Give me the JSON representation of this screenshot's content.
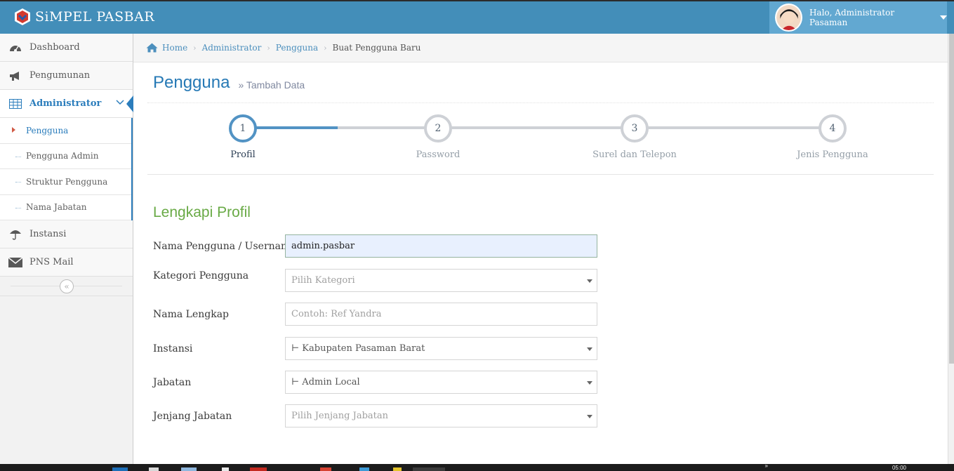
{
  "app": {
    "brand": "SiMPEL PASBAR",
    "greeting": "Halo, Administrator Pasaman"
  },
  "sidebar": {
    "items": [
      {
        "label": "Dashboard",
        "icon": "dashboard-icon"
      },
      {
        "label": "Pengumunan",
        "icon": "bullhorn-icon"
      },
      {
        "label": "Administrator",
        "icon": "table-icon",
        "active": true
      },
      {
        "label": "Instansi",
        "icon": "umbrella-icon"
      },
      {
        "label": "PNS Mail",
        "icon": "envelope-icon"
      }
    ],
    "submenu": [
      "Pengguna",
      "Pengguna Admin",
      "Struktur Pengguna",
      "Nama Jabatan"
    ],
    "collapse_glyph": "«"
  },
  "breadcrumb": [
    "Home",
    "Administrator",
    "Pengguna",
    "Buat Pengguna Baru"
  ],
  "page": {
    "title": "Pengguna",
    "subtitle": "» Tambah Data"
  },
  "wizard": {
    "current_step": 1,
    "steps": [
      {
        "num": "1",
        "title": "Profil"
      },
      {
        "num": "2",
        "title": "Password"
      },
      {
        "num": "3",
        "title": "Surel dan Telepon"
      },
      {
        "num": "4",
        "title": "Jenis Pengguna"
      }
    ]
  },
  "form": {
    "section_title": "Lengkapi Profil",
    "username": {
      "label": "Nama Pengguna / Username",
      "value": "admin.pasbar"
    },
    "kategori": {
      "label": "Kategori Pengguna",
      "placeholder": "Pilih Kategori"
    },
    "nama_lengkap": {
      "label": "Nama Lengkap",
      "placeholder": "Contoh: Ref Yandra"
    },
    "instansi": {
      "label": "Instansi",
      "value": "⊢ Kabupaten Pasaman Barat"
    },
    "jabatan": {
      "label": "Jabatan",
      "value": "⊢ Admin Local"
    },
    "jenjang": {
      "label": "Jenjang Jabatan",
      "placeholder": "Pilih Jenjang Jabatan"
    }
  },
  "taskbar": {
    "clock": "05:00",
    "overflow": "»"
  },
  "colors": {
    "navbar": "#438eb9",
    "user_box": "#62a8d1",
    "accent_blue": "#2679b5",
    "step_active": "#5293c4",
    "section_green": "#69aa46"
  }
}
